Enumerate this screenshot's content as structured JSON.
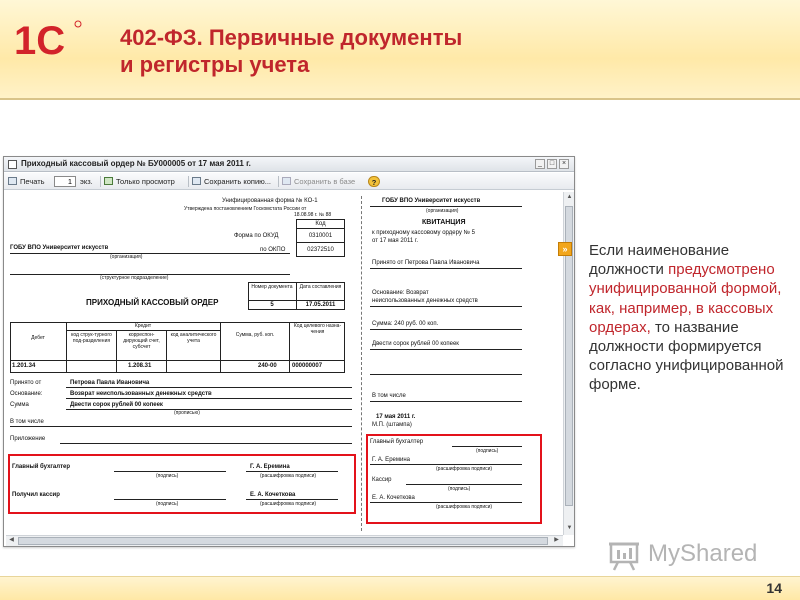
{
  "header": {
    "logo_text": "1С",
    "title_line1": "402-ФЗ. Первичные документы",
    "title_line2": "и регистры учета"
  },
  "window": {
    "title": "Приходный кассовый ордер № БУ000005 от 17 мая 2011 г.",
    "controls": [
      "_",
      "□",
      "×"
    ],
    "toolbar": {
      "print": "Печать",
      "copies": "1",
      "copies_unit": "экз.",
      "view_only": "Только просмотр",
      "save_copy": "Сохранить копию...",
      "save_db": "Сохранить в базе",
      "help": "?"
    }
  },
  "form": {
    "left": {
      "unified_form": "Унифицированная форма № КО-1",
      "approved": "Утверждена постановлением Госкомстата России от",
      "approved_date": "18.08.98 г. № 88",
      "code_label": "Код",
      "okud_label": "Форма по ОКУД",
      "okud_value": "0310001",
      "okpo_label": "по ОКПО",
      "okpo_value": "02372510",
      "org_name": "ГОБУ ВПО Университет искусств",
      "org_caption": "(организация)",
      "struct_caption": "(структурное подразделение)",
      "doc_title": "ПРИХОДНЫЙ КАССОВЫЙ ОРДЕР",
      "docnum_label": "Номер документа",
      "docdate_label": "Дата составления",
      "docnum_value": "5",
      "docdate_value": "17.05.2011",
      "table": {
        "debit": "Дебет",
        "credit": "Кредит",
        "sub_code": "код струк-турного под-разделения",
        "corr_account": "корреспон-дирующий счет, субсчет",
        "analytics": "код аналитического учета",
        "sum": "Сумма, руб. коп.",
        "purpose_code": "Код целевого назна-чения",
        "row": {
          "debit": "1.201.34",
          "corr": "1.208.31",
          "sum": "240-00",
          "purpose": "000000007"
        }
      },
      "received_from_label": "Принято от",
      "received_from_value": "Петрова Павла Ивановича",
      "basis_label": "Основание:",
      "basis_value": "Возврат неиспользованных денежных средств",
      "sum_label": "Сумма",
      "sum_value": "Двести сорок рублей 00 копеек",
      "in_words": "(прописью)",
      "incl_label": "В том числе",
      "attachment_label": "Приложение",
      "chief_label": "Главный бухгалтер",
      "chief_name": "Г. А. Еремина",
      "cashier_label": "Получил кассир",
      "cashier_name": "Е. А. Кочеткова",
      "sign_caption": "(подпись)",
      "decode_caption": "(расшифровка подписи)"
    },
    "right": {
      "org_name": "ГОБУ ВПО Университет искусств",
      "org_caption": "(организация)",
      "receipt_title": "КВИТАНЦИЯ",
      "to_order": "к приходному кассовому ордеру № 5",
      "from_date": "от 17 мая 2011 г.",
      "received_from": "Принято от Петрова Павла Ивановича",
      "basis_line1": "Основание: Возврат",
      "basis_line2": "неиспользованных денежных средств",
      "sum_line": "Сумма: 240 руб. 00 коп.",
      "sum_words": "Двести сорок рублей 00 копеек",
      "incl": "В том числе",
      "date": "17 мая 2011 г.",
      "stamp": "М.П. (штампа)",
      "chief_label": "Главный бухгалтер",
      "chief_name": "Г. А. Еремина",
      "cashier_label": "Кассир",
      "cashier_name": "Е. А. Кочеткова",
      "sign_caption": "(подпись)",
      "decode_caption": "(расшифровка подписи)"
    }
  },
  "note": {
    "bullet": "»",
    "p1": "Если наименование должности ",
    "p2": "предусмотрено унифицированной формой, как, например, в кассовых ордерах,",
    "p3": " то название должности формируется согласно унифицированной форме.",
    "text_color": "#333333",
    "accent_color": "#c0262c"
  },
  "watermark": "MyShared",
  "page_number": "14"
}
